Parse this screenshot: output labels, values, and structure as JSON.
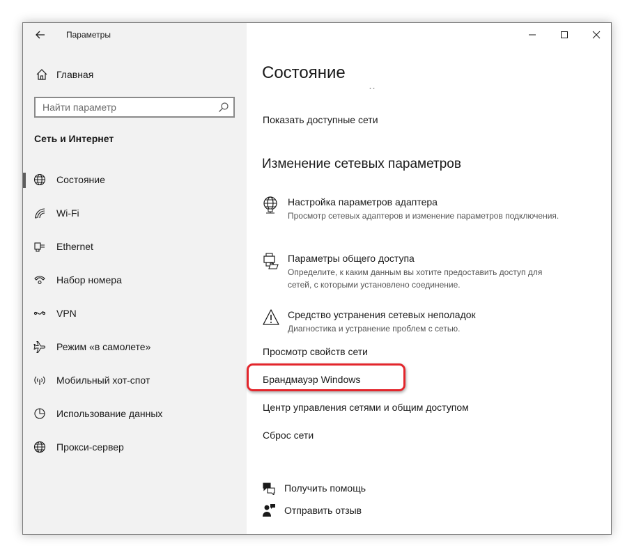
{
  "window": {
    "title": "Параметры",
    "controls": {
      "minimize": "minimize",
      "maximize": "maximize",
      "close": "close"
    }
  },
  "sidebar": {
    "home_label": "Главная",
    "search": {
      "placeholder": "Найти параметр",
      "value": ""
    },
    "section_title": "Сеть и Интернет",
    "items": [
      {
        "label": "Состояние",
        "icon": "globe-icon",
        "selected": true
      },
      {
        "label": "Wi-Fi",
        "icon": "wifi-icon"
      },
      {
        "label": "Ethernet",
        "icon": "ethernet-icon"
      },
      {
        "label": "Набор номера",
        "icon": "dialup-icon"
      },
      {
        "label": "VPN",
        "icon": "vpn-icon"
      },
      {
        "label": "Режим «в самолете»",
        "icon": "airplane-icon"
      },
      {
        "label": "Мобильный хот-спот",
        "icon": "hotspot-icon"
      },
      {
        "label": "Использование данных",
        "icon": "data-usage-icon"
      },
      {
        "label": "Прокси-сервер",
        "icon": "proxy-globe-icon"
      }
    ]
  },
  "main": {
    "page_title": "Состояние",
    "show_networks_link": "Показать доступные сети",
    "change_heading": "Изменение сетевых параметров",
    "settings": [
      {
        "title": "Настройка параметров адаптера",
        "description": "Просмотр сетевых адаптеров и изменение параметров подключения.",
        "icon": "network-globe-icon"
      },
      {
        "title": "Параметры общего доступа",
        "description": "Определите, к каким данным вы хотите предоставить доступ для сетей, с которыми установлено соединение.",
        "icon": "sharing-icon"
      },
      {
        "title": "Средство устранения сетевых неполадок",
        "description": "Диагностика и устранение проблем с сетью.",
        "icon": "warning-icon"
      }
    ],
    "links": {
      "view_properties": "Просмотр свойств сети",
      "firewall": "Брандмауэр Windows",
      "network_center": "Центр управления сетями и общим доступом",
      "reset": "Сброс сети"
    },
    "help": {
      "get_help": "Получить помощь",
      "feedback": "Отправить отзыв"
    },
    "highlight_color": "#e3262c"
  }
}
